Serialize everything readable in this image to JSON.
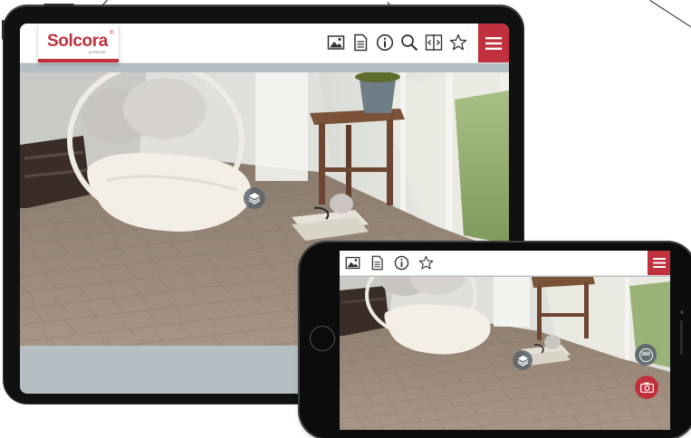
{
  "brand": {
    "name": "Solcora",
    "mark": "®",
    "byline": "by IPINTER",
    "accent": "#c1313d"
  },
  "tablet": {
    "toolbar_icons": [
      "image-icon",
      "document-icon",
      "info-icon",
      "search-icon",
      "compare-icon",
      "favorite-star-icon"
    ],
    "menu_icon": "hamburger-menu-icon"
  },
  "phone": {
    "toolbar_icons": [
      "image-icon",
      "document-icon",
      "info-icon",
      "favorite-star-icon"
    ],
    "menu_icon": "hamburger-menu-icon",
    "view_360_label": "360",
    "camera_icon": "camera-icon"
  },
  "scene": {
    "floor": "light oak herringbone",
    "layers_icon": "layers-icon"
  }
}
